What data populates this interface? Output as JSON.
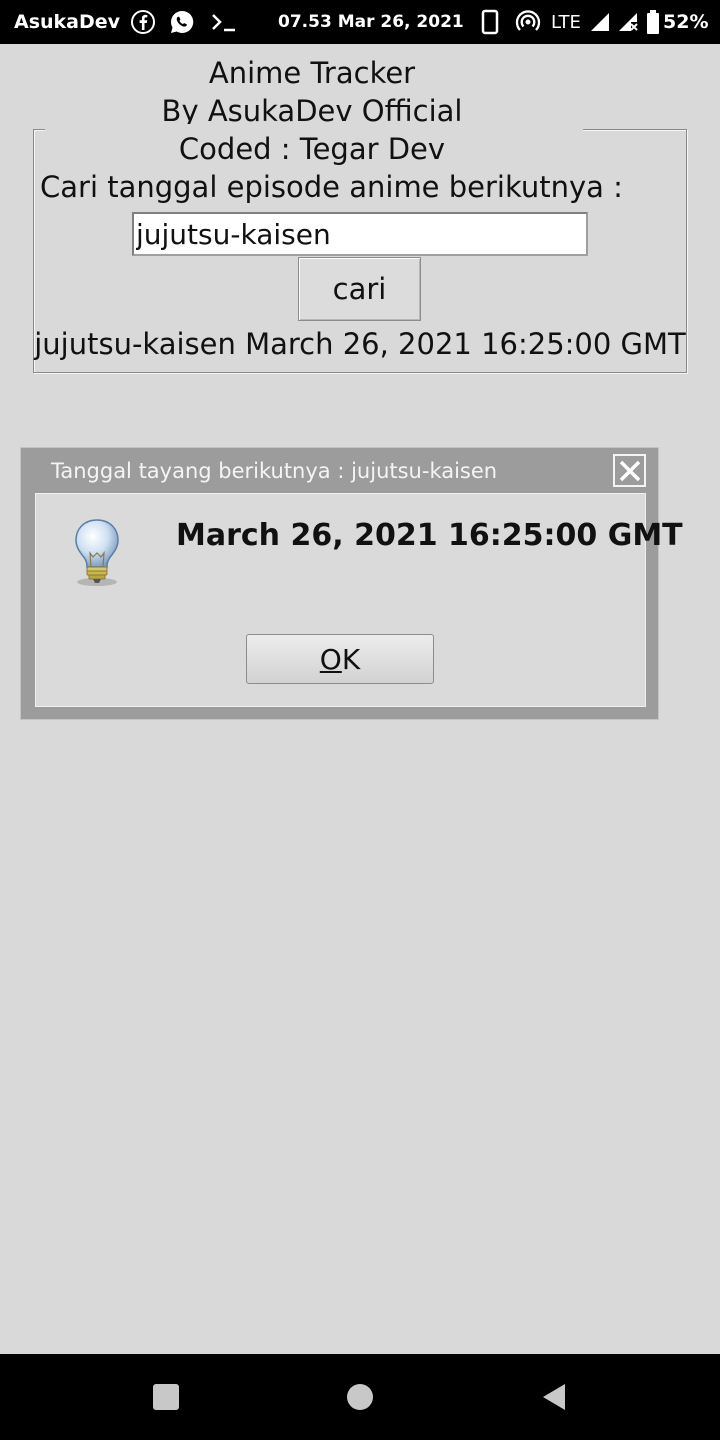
{
  "status_bar": {
    "carrier": "AsukaDev",
    "clock": "07.53 Mar 26, 2021",
    "network": "LTE",
    "battery": "52%",
    "icons": [
      "facebook-icon",
      "whatsapp-icon",
      "terminal-icon",
      "phone-icon",
      "hotspot-icon",
      "signal-icon",
      "signal-x-icon",
      "battery-icon"
    ]
  },
  "app": {
    "title": "Anime Tracker",
    "author": "By AsukaDev Official",
    "coder": "Coded : Tegar Dev",
    "search_label": "Cari tanggal episode anime berikutnya :",
    "search_value": "jujutsu-kaisen",
    "search_button": "cari",
    "result_text": "jujutsu-kaisen March 26, 2021 16:25:00 GMT"
  },
  "dialog": {
    "title": "Tanggal tayang berikutnya : jujutsu-kaisen",
    "message": "March 26, 2021 16:25:00 GMT",
    "ok_mnemonic": "O",
    "ok_rest": "K",
    "icon": "lightbulb-icon"
  },
  "nav_bar": {
    "icons": [
      "recent-apps-icon",
      "home-icon",
      "back-icon"
    ]
  },
  "colors": {
    "background": "#d9d9d9",
    "dialog_frame": "#9c9c9c",
    "status_bar": "#000000"
  }
}
